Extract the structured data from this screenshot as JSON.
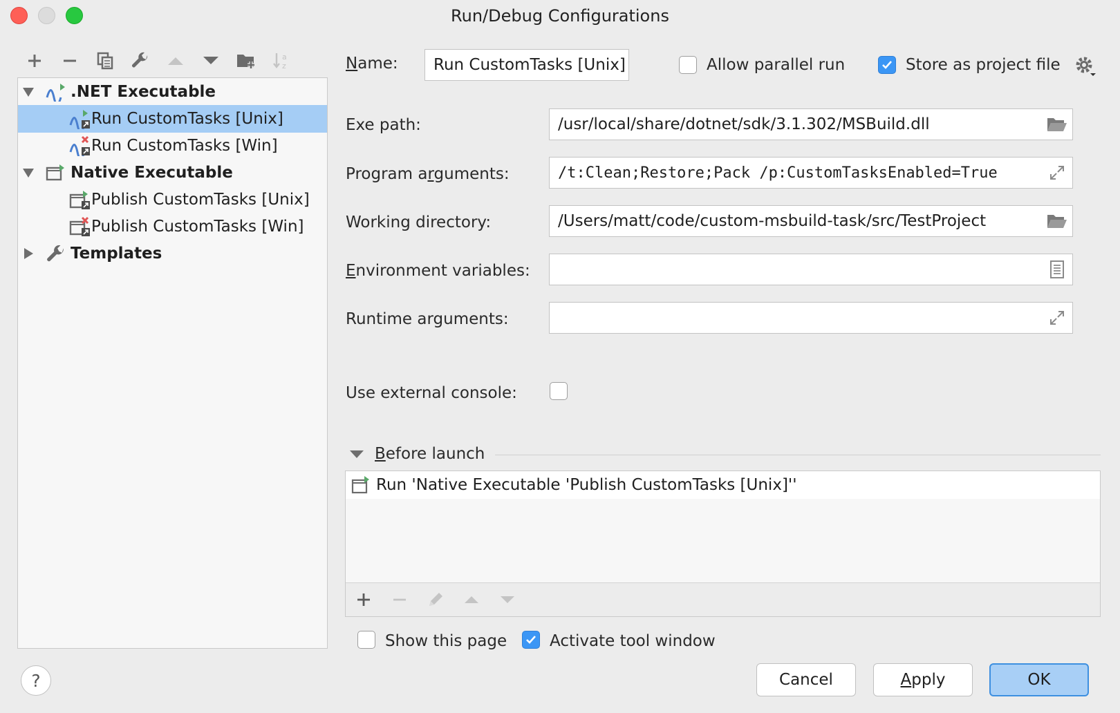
{
  "window": {
    "title": "Run/Debug Configurations"
  },
  "toolbar": {
    "icons": [
      "plus-icon",
      "minus-icon",
      "copy-icon",
      "wrench-icon",
      "arrow-up-icon",
      "arrow-down-icon",
      "new-folder-icon",
      "sort-alpha-icon"
    ]
  },
  "tree": {
    "groups": [
      {
        "label": ".NET Executable",
        "expanded": true,
        "icon": "dotnet-icon",
        "items": [
          {
            "label": "Run CustomTasks [Unix]",
            "selected": true,
            "icon": "dotnet-run-icon"
          },
          {
            "label": "Run CustomTasks [Win]",
            "selected": false,
            "icon": "dotnet-error-icon"
          }
        ]
      },
      {
        "label": "Native Executable",
        "expanded": true,
        "icon": "native-exec-icon",
        "items": [
          {
            "label": "Publish CustomTasks [Unix]",
            "icon": "native-run-icon"
          },
          {
            "label": "Publish CustomTasks [Win]",
            "icon": "native-error-icon"
          }
        ]
      },
      {
        "label": "Templates",
        "expanded": false,
        "icon": "wrench-icon",
        "items": []
      }
    ]
  },
  "form": {
    "name_label": "Name:",
    "name_value": "Run CustomTasks [Unix]",
    "allow_parallel_label": "Allow parallel run",
    "allow_parallel_checked": false,
    "store_project_label": "Store as project file",
    "store_project_checked": true,
    "exe_path_label": "Exe path:",
    "exe_path_value": "/usr/local/share/dotnet/sdk/3.1.302/MSBuild.dll",
    "program_args_label": "Program arguments:",
    "program_args_value": "/t:Clean;Restore;Pack /p:CustomTasksEnabled=True",
    "working_dir_label": "Working directory:",
    "working_dir_value": "/Users/matt/code/custom-msbuild-task/src/TestProject",
    "env_vars_label": "Environment variables:",
    "env_vars_value": "",
    "runtime_args_label": "Runtime arguments:",
    "runtime_args_value": "",
    "external_console_label": "Use external console:",
    "external_console_checked": false
  },
  "before_launch": {
    "title": "Before launch",
    "items": [
      {
        "label": "Run 'Native Executable 'Publish CustomTasks [Unix]''",
        "icon": "native-run-icon"
      }
    ],
    "show_page_label": "Show this page",
    "show_page_checked": false,
    "activate_tool_label": "Activate tool window",
    "activate_tool_checked": true
  },
  "buttons": {
    "help": "?",
    "cancel": "Cancel",
    "apply": "Apply",
    "ok": "OK"
  },
  "colors": {
    "selection": "#a5cdf5",
    "accent": "#3b96f5",
    "run_green": "#59a869",
    "error_red": "#e05555"
  }
}
